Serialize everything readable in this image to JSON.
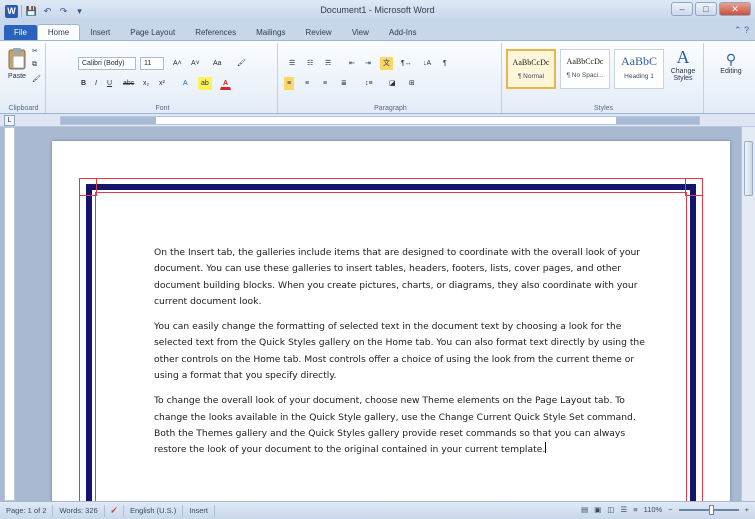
{
  "window": {
    "title": "Document1 - Microsoft Word",
    "minimize": "–",
    "maximize": "□",
    "close": "✕"
  },
  "qat": {
    "app_icon": "W",
    "save": "💾",
    "undo": "↶",
    "redo": "↷",
    "customize": "▾"
  },
  "tabs": [
    "File",
    "Home",
    "Insert",
    "Page Layout",
    "References",
    "Mailings",
    "Review",
    "View",
    "Add-Ins"
  ],
  "active_tab": "Home",
  "ribbon": {
    "clipboard": {
      "label": "Clipboard",
      "paste": "Paste"
    },
    "font": {
      "label": "Font",
      "font_name": "Calibri (Body)",
      "font_size": "11",
      "bold": "B",
      "italic": "I",
      "underline": "U",
      "strike": "abc",
      "subscript": "x₂",
      "superscript": "x²",
      "grow": "A˄",
      "shrink": "A˅",
      "case": "Aa",
      "clear": "🖌",
      "highlight": "ab",
      "color": "A"
    },
    "paragraph": {
      "label": "Paragraph"
    },
    "styles": {
      "label": "Styles",
      "items": [
        {
          "sample": "AaBbCcDc",
          "name": "¶ Normal"
        },
        {
          "sample": "AaBbCcDc",
          "name": "¶ No Spaci..."
        },
        {
          "sample": "AaBbC",
          "name": "Heading 1"
        }
      ],
      "change_styles": "Change Styles"
    },
    "editing": {
      "label": "Editing"
    }
  },
  "document": {
    "paragraphs": [
      "On the Insert tab, the galleries include items that are designed to coordinate with the overall look of your document. You can use these galleries to insert tables, headers, footers, lists, cover pages, and other document building blocks. When you create pictures, charts, or diagrams, they also coordinate with your current document look.",
      "You can easily change the formatting of selected text in the document text by choosing a look for the selected text from the Quick Styles gallery on the Home tab. You can also format text directly by using the other controls on the Home tab. Most controls offer a choice of using the look from the current theme or using a format that you specify directly.",
      "To change the overall look of your document, choose new Theme elements on the Page Layout tab. To change the looks available in the Quick Style gallery, use the Change Current Quick Style Set command. Both the Themes gallery and the Quick Styles gallery provide reset commands so that you can always restore the look of your document to the original contained in your current template."
    ]
  },
  "status": {
    "page": "Page: 1 of 2",
    "words": "Words: 326",
    "language": "English (U.S.)",
    "mode": "Insert",
    "zoom": "110%",
    "zoom_minus": "−",
    "zoom_plus": "+"
  },
  "colors": {
    "border_navy": "#17146b",
    "border_red": "#e33a4a",
    "file_tab": "#2a62bd"
  }
}
